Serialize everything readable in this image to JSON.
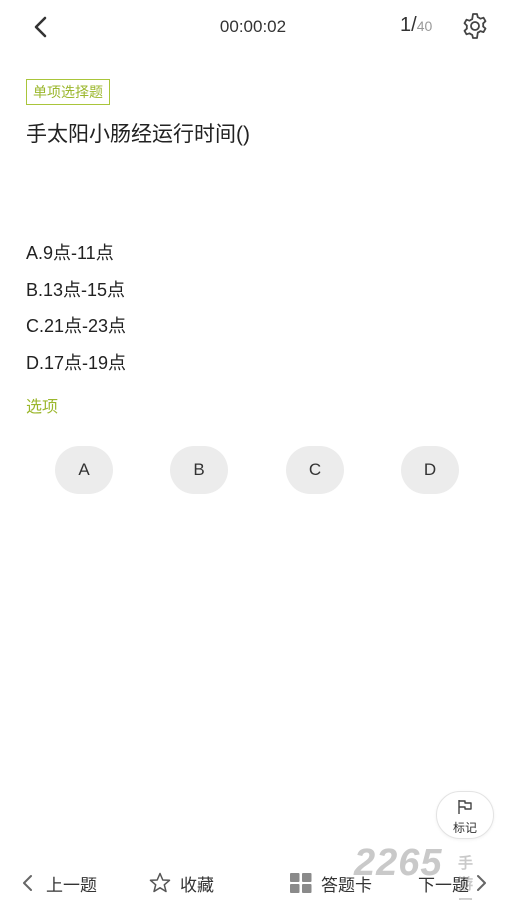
{
  "header": {
    "timer": "00:00:02",
    "current": "1/",
    "total": "40"
  },
  "question": {
    "type_badge": "单项选择题",
    "text": "手太阳小肠经运行时间()",
    "options": [
      "A.9点-11点",
      "B.13点-15点",
      "C.21点-23点",
      "D.17点-19点"
    ]
  },
  "answer": {
    "section_label": "选项",
    "buttons": [
      "A",
      "B",
      "C",
      "D"
    ]
  },
  "flag": {
    "label": "标记"
  },
  "bottom": {
    "prev": "上一题",
    "favorite": "收藏",
    "card": "答题卡",
    "next": "下一题"
  },
  "watermark": {
    "number": "2265",
    "text": "手游网"
  },
  "colors": {
    "accent": "#9bb72c",
    "button_bg": "#ececec"
  },
  "icons": [
    "back-icon",
    "gear-icon",
    "flag-icon",
    "chevron-left-icon",
    "star-icon",
    "grid-icon",
    "chevron-right-icon"
  ]
}
